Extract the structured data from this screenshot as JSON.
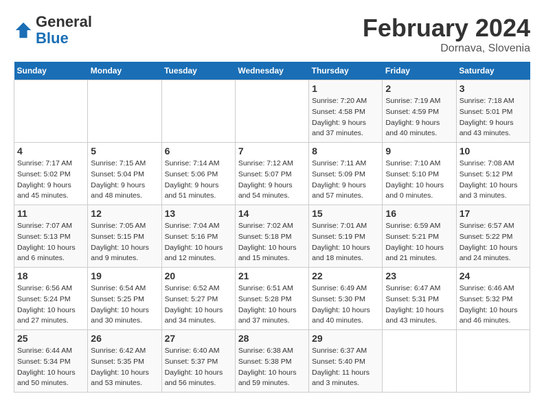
{
  "header": {
    "logo_general": "General",
    "logo_blue": "Blue",
    "main_title": "February 2024",
    "subtitle": "Dornava, Slovenia"
  },
  "days_of_week": [
    "Sunday",
    "Monday",
    "Tuesday",
    "Wednesday",
    "Thursday",
    "Friday",
    "Saturday"
  ],
  "weeks": [
    [
      {
        "day": "",
        "info": ""
      },
      {
        "day": "",
        "info": ""
      },
      {
        "day": "",
        "info": ""
      },
      {
        "day": "",
        "info": ""
      },
      {
        "day": "1",
        "info": "Sunrise: 7:20 AM\nSunset: 4:58 PM\nDaylight: 9 hours\nand 37 minutes."
      },
      {
        "day": "2",
        "info": "Sunrise: 7:19 AM\nSunset: 4:59 PM\nDaylight: 9 hours\nand 40 minutes."
      },
      {
        "day": "3",
        "info": "Sunrise: 7:18 AM\nSunset: 5:01 PM\nDaylight: 9 hours\nand 43 minutes."
      }
    ],
    [
      {
        "day": "4",
        "info": "Sunrise: 7:17 AM\nSunset: 5:02 PM\nDaylight: 9 hours\nand 45 minutes."
      },
      {
        "day": "5",
        "info": "Sunrise: 7:15 AM\nSunset: 5:04 PM\nDaylight: 9 hours\nand 48 minutes."
      },
      {
        "day": "6",
        "info": "Sunrise: 7:14 AM\nSunset: 5:06 PM\nDaylight: 9 hours\nand 51 minutes."
      },
      {
        "day": "7",
        "info": "Sunrise: 7:12 AM\nSunset: 5:07 PM\nDaylight: 9 hours\nand 54 minutes."
      },
      {
        "day": "8",
        "info": "Sunrise: 7:11 AM\nSunset: 5:09 PM\nDaylight: 9 hours\nand 57 minutes."
      },
      {
        "day": "9",
        "info": "Sunrise: 7:10 AM\nSunset: 5:10 PM\nDaylight: 10 hours\nand 0 minutes."
      },
      {
        "day": "10",
        "info": "Sunrise: 7:08 AM\nSunset: 5:12 PM\nDaylight: 10 hours\nand 3 minutes."
      }
    ],
    [
      {
        "day": "11",
        "info": "Sunrise: 7:07 AM\nSunset: 5:13 PM\nDaylight: 10 hours\nand 6 minutes."
      },
      {
        "day": "12",
        "info": "Sunrise: 7:05 AM\nSunset: 5:15 PM\nDaylight: 10 hours\nand 9 minutes."
      },
      {
        "day": "13",
        "info": "Sunrise: 7:04 AM\nSunset: 5:16 PM\nDaylight: 10 hours\nand 12 minutes."
      },
      {
        "day": "14",
        "info": "Sunrise: 7:02 AM\nSunset: 5:18 PM\nDaylight: 10 hours\nand 15 minutes."
      },
      {
        "day": "15",
        "info": "Sunrise: 7:01 AM\nSunset: 5:19 PM\nDaylight: 10 hours\nand 18 minutes."
      },
      {
        "day": "16",
        "info": "Sunrise: 6:59 AM\nSunset: 5:21 PM\nDaylight: 10 hours\nand 21 minutes."
      },
      {
        "day": "17",
        "info": "Sunrise: 6:57 AM\nSunset: 5:22 PM\nDaylight: 10 hours\nand 24 minutes."
      }
    ],
    [
      {
        "day": "18",
        "info": "Sunrise: 6:56 AM\nSunset: 5:24 PM\nDaylight: 10 hours\nand 27 minutes."
      },
      {
        "day": "19",
        "info": "Sunrise: 6:54 AM\nSunset: 5:25 PM\nDaylight: 10 hours\nand 30 minutes."
      },
      {
        "day": "20",
        "info": "Sunrise: 6:52 AM\nSunset: 5:27 PM\nDaylight: 10 hours\nand 34 minutes."
      },
      {
        "day": "21",
        "info": "Sunrise: 6:51 AM\nSunset: 5:28 PM\nDaylight: 10 hours\nand 37 minutes."
      },
      {
        "day": "22",
        "info": "Sunrise: 6:49 AM\nSunset: 5:30 PM\nDaylight: 10 hours\nand 40 minutes."
      },
      {
        "day": "23",
        "info": "Sunrise: 6:47 AM\nSunset: 5:31 PM\nDaylight: 10 hours\nand 43 minutes."
      },
      {
        "day": "24",
        "info": "Sunrise: 6:46 AM\nSunset: 5:32 PM\nDaylight: 10 hours\nand 46 minutes."
      }
    ],
    [
      {
        "day": "25",
        "info": "Sunrise: 6:44 AM\nSunset: 5:34 PM\nDaylight: 10 hours\nand 50 minutes."
      },
      {
        "day": "26",
        "info": "Sunrise: 6:42 AM\nSunset: 5:35 PM\nDaylight: 10 hours\nand 53 minutes."
      },
      {
        "day": "27",
        "info": "Sunrise: 6:40 AM\nSunset: 5:37 PM\nDaylight: 10 hours\nand 56 minutes."
      },
      {
        "day": "28",
        "info": "Sunrise: 6:38 AM\nSunset: 5:38 PM\nDaylight: 10 hours\nand 59 minutes."
      },
      {
        "day": "29",
        "info": "Sunrise: 6:37 AM\nSunset: 5:40 PM\nDaylight: 11 hours\nand 3 minutes."
      },
      {
        "day": "",
        "info": ""
      },
      {
        "day": "",
        "info": ""
      }
    ]
  ]
}
